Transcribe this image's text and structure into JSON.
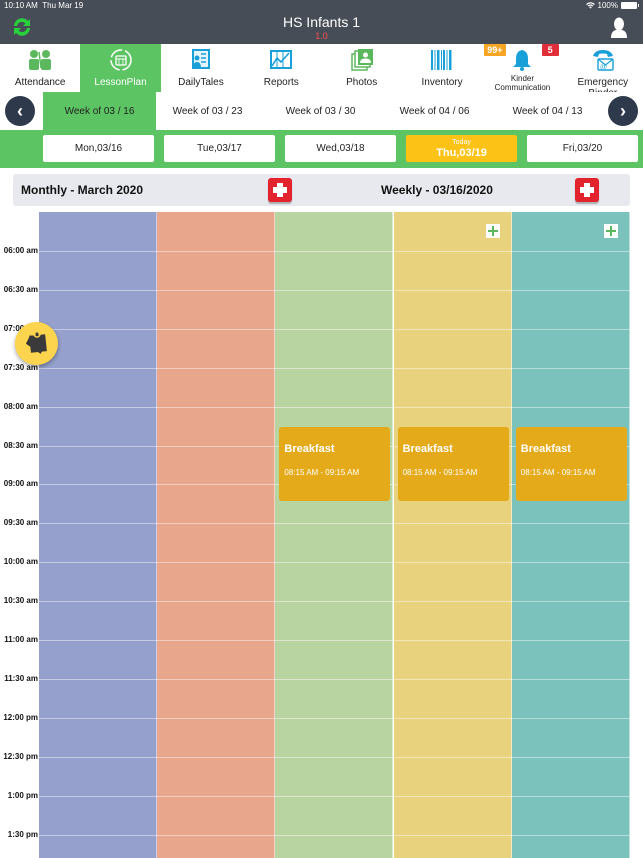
{
  "status_bar": {
    "time": "10:10 AM",
    "date": "Thu Mar 19",
    "battery": "100%"
  },
  "header": {
    "title": "HS Infants 1",
    "version": "1.0"
  },
  "nav": [
    {
      "label": "Attendance",
      "icon": "attendance-icon"
    },
    {
      "label": "LessonPlan",
      "icon": "lesson-plan-icon",
      "active": true
    },
    {
      "label": "DailyTales",
      "icon": "daily-tales-icon"
    },
    {
      "label": "Reports",
      "icon": "reports-icon"
    },
    {
      "label": "Photos",
      "icon": "photos-icon"
    },
    {
      "label": "Inventory",
      "icon": "barcode-icon"
    },
    {
      "label": "Kinder Communication",
      "icon": "bell-icon",
      "badge_left": "99+",
      "badge_right": "5"
    },
    {
      "label": "Emergency Binder",
      "icon": "emergency-phone-icon"
    }
  ],
  "weeks": [
    "Week of 03 / 16",
    "Week of 03 / 23",
    "Week of 03 / 30",
    "Week of 04 / 06",
    "Week of 04 / 13"
  ],
  "days": [
    {
      "label": "Mon,03/16"
    },
    {
      "label": "Tue,03/17"
    },
    {
      "label": "Wed,03/18"
    },
    {
      "label": "Thu,03/19",
      "today_label": "Today"
    },
    {
      "label": "Fri,03/20"
    }
  ],
  "section": {
    "monthly": "Monthly - March 2020",
    "weekly": "Weekly - 03/16/2020"
  },
  "times": [
    "06:00 am",
    "06:30 am",
    "07:00 am",
    "07:30 am",
    "08:00 am",
    "08:30 am",
    "09:00 am",
    "09:30 am",
    "10:00 am",
    "10:30 am",
    "11:00 am",
    "11:30 am",
    "12:00 pm",
    "12:30 pm",
    "1:00 pm",
    "1:30 pm"
  ],
  "column_colors": [
    "#95a1cc",
    "#e8a68c",
    "#b8d4a0",
    "#e8d27e",
    "#7cc2bc"
  ],
  "events": [
    {
      "day": 2,
      "name": "Breakfast",
      "time": "08:15 AM - 09:15 AM"
    },
    {
      "day": 3,
      "name": "Breakfast",
      "time": "08:15 AM - 09:15 AM"
    },
    {
      "day": 4,
      "name": "Breakfast",
      "time": "08:15 AM - 09:15 AM"
    }
  ],
  "colors": {
    "accent_green": "#5cc463",
    "today": "#fcc216",
    "event": "#e4aa1a",
    "header": "#474d57",
    "add_red": "#e2232e"
  }
}
